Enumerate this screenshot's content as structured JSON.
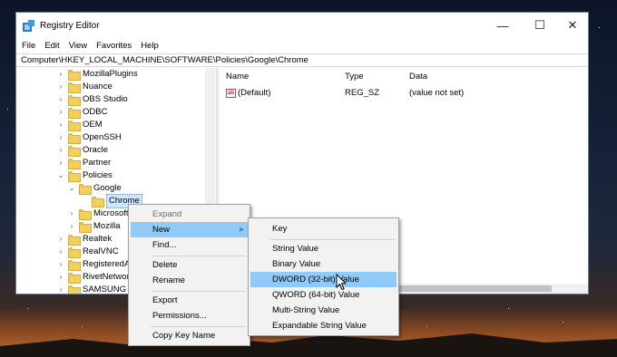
{
  "window": {
    "title": "Registry Editor",
    "minimize_glyph": "—",
    "maximize_glyph": "☐",
    "close_glyph": "✕"
  },
  "menubar": [
    "File",
    "Edit",
    "View",
    "Favorites",
    "Help"
  ],
  "address": "Computer\\HKEY_LOCAL_MACHINE\\SOFTWARE\\Policies\\Google\\Chrome",
  "tree": [
    {
      "label": "MozillaPlugins",
      "chevron": "›"
    },
    {
      "label": "Nuance",
      "chevron": "›"
    },
    {
      "label": "OBS Studio",
      "chevron": "›"
    },
    {
      "label": "ODBC",
      "chevron": "›"
    },
    {
      "label": "OEM",
      "chevron": "›"
    },
    {
      "label": "OpenSSH",
      "chevron": "›"
    },
    {
      "label": "Oracle",
      "chevron": "›"
    },
    {
      "label": "Partner",
      "chevron": "›"
    },
    {
      "label": "Policies",
      "chevron": "⌄"
    },
    {
      "label": "Google",
      "chevron": "⌄"
    },
    {
      "label": "Chrome",
      "chevron": ""
    },
    {
      "label": "Microsoft",
      "chevron": "›"
    },
    {
      "label": "Mozilla",
      "chevron": "›"
    },
    {
      "label": "Realtek",
      "chevron": "›"
    },
    {
      "label": "RealVNC",
      "chevron": "›"
    },
    {
      "label": "RegisteredApplications",
      "chevron": "›"
    },
    {
      "label": "RivetNetworks",
      "chevron": "›"
    },
    {
      "label": "SAMSUNG",
      "chevron": "›"
    }
  ],
  "columns": {
    "name": "Name",
    "type": "Type",
    "data": "Data"
  },
  "values": [
    {
      "icon": "ab",
      "name": "(Default)",
      "type": "REG_SZ",
      "data": "(value not set)"
    }
  ],
  "context_menu": {
    "expand": "Expand",
    "new": "New",
    "find": "Find...",
    "delete": "Delete",
    "rename": "Rename",
    "export": "Export",
    "permissions": "Permissions...",
    "copy_key_name": "Copy Key Name",
    "submenu_arrow": ">"
  },
  "new_submenu": {
    "key": "Key",
    "string_value": "String Value",
    "binary_value": "Binary Value",
    "dword": "DWORD (32-bit) Value",
    "qword": "QWORD (64-bit) Value",
    "multi_string": "Multi-String Value",
    "expandable_string": "Expandable String Value"
  },
  "colors": {
    "highlight": "#91c9f7",
    "selection": "#cce8ff",
    "folder": "#f4cf5c"
  }
}
